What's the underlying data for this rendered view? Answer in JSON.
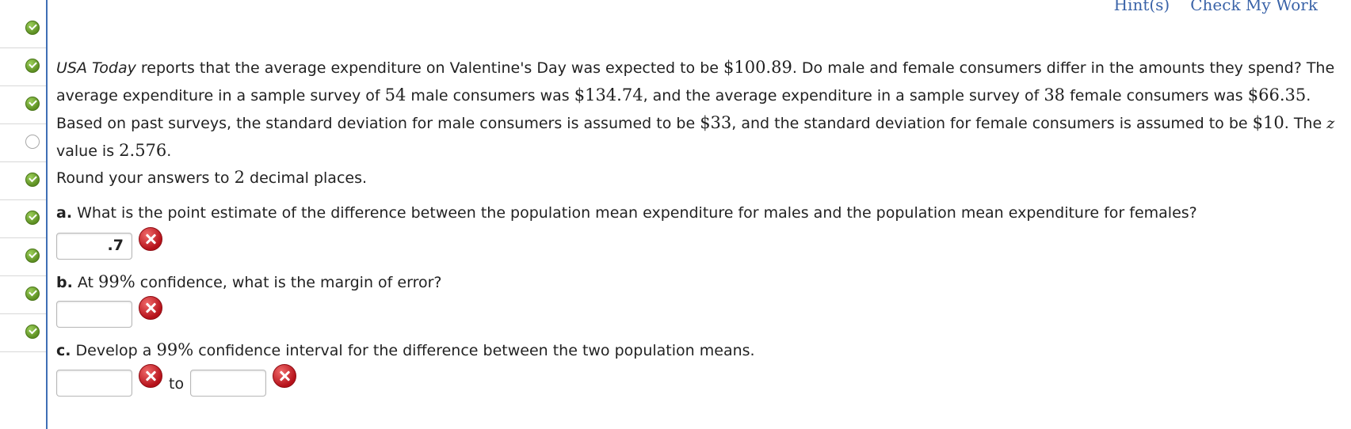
{
  "header": {
    "hints_link": "Hint(s)",
    "check_link": "Check My Work"
  },
  "status": [
    "done",
    "done",
    "done",
    "empty",
    "done",
    "done",
    "done",
    "done",
    "done"
  ],
  "problem": {
    "source": "USA Today",
    "p1_a": " reports that the average expenditure on Valentine's Day was expected to be ",
    "v1": "$100.89",
    "p1_b": ". Do male and female consumers differ in the amounts they spend? The average expenditure in a sample survey of ",
    "v2": "54",
    "p1_c": " male consumers was ",
    "v3": "$134.74",
    "p1_d": ", and the average expenditure in a sample survey of ",
    "v4": "38",
    "p1_e": " female consumers was ",
    "v5": "$66.35",
    "p1_f": ". Based on past surveys, the standard deviation for male consumers is assumed to be ",
    "v6": "$33",
    "p1_g": ", and the standard deviation for female consumers is assumed to be ",
    "v7": "$10",
    "p1_h": ". The ",
    "zvar": "z",
    "p1_i": " value is ",
    "v8": "2.576",
    "p1_j": ".",
    "round_a": "Round your answers to ",
    "round_n": "2",
    "round_b": " decimal places."
  },
  "questions": {
    "a_label": "a.",
    "a_text": " What is the point estimate of the difference between the population mean expenditure for males and the population mean expenditure for females?",
    "a_value": ".7",
    "b_label": "b.",
    "b_text_1": " At ",
    "b_pct": "99%",
    "b_text_2": " confidence, what is the margin of error?",
    "b_value": "",
    "c_label": "c.",
    "c_text_1": " Develop a ",
    "c_pct": "99%",
    "c_text_2": " confidence interval for the difference between the two population means.",
    "c_low": "",
    "c_high": "",
    "to": "to"
  }
}
